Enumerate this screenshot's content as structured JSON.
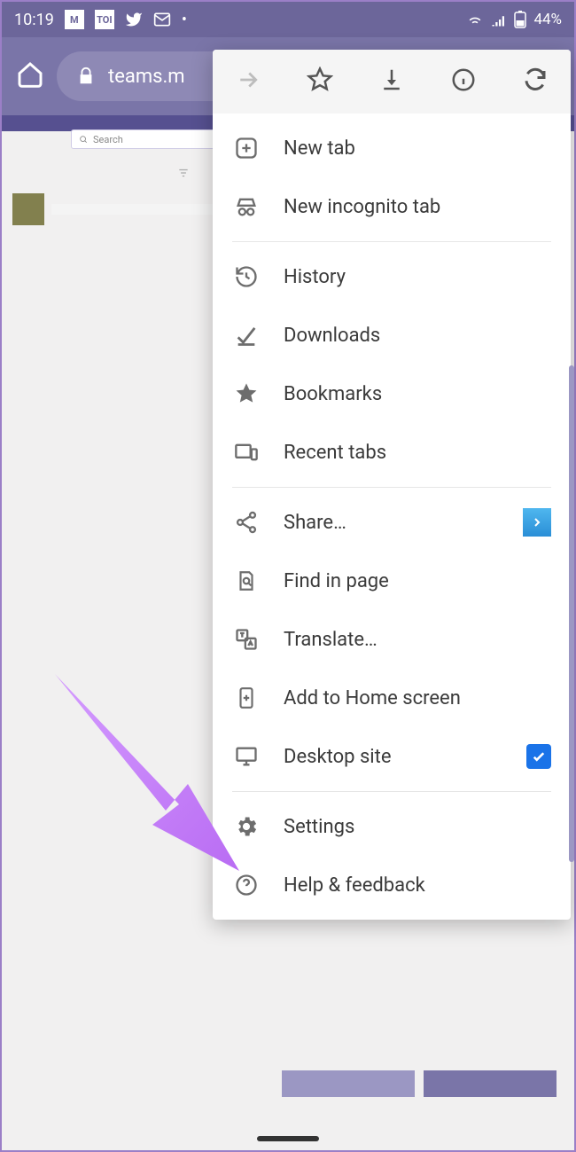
{
  "status": {
    "time": "10:19",
    "battery": "44%",
    "icons": [
      "M",
      "TOI"
    ]
  },
  "addressbar": {
    "url": "teams.m"
  },
  "page": {
    "search_placeholder": "Search"
  },
  "menu": {
    "new_tab": "New tab",
    "incognito": "New incognito tab",
    "history": "History",
    "downloads": "Downloads",
    "bookmarks": "Bookmarks",
    "recent_tabs": "Recent tabs",
    "share": "Share…",
    "find": "Find in page",
    "translate": "Translate…",
    "add_home": "Add to Home screen",
    "desktop": "Desktop site",
    "settings": "Settings",
    "help": "Help & feedback"
  }
}
